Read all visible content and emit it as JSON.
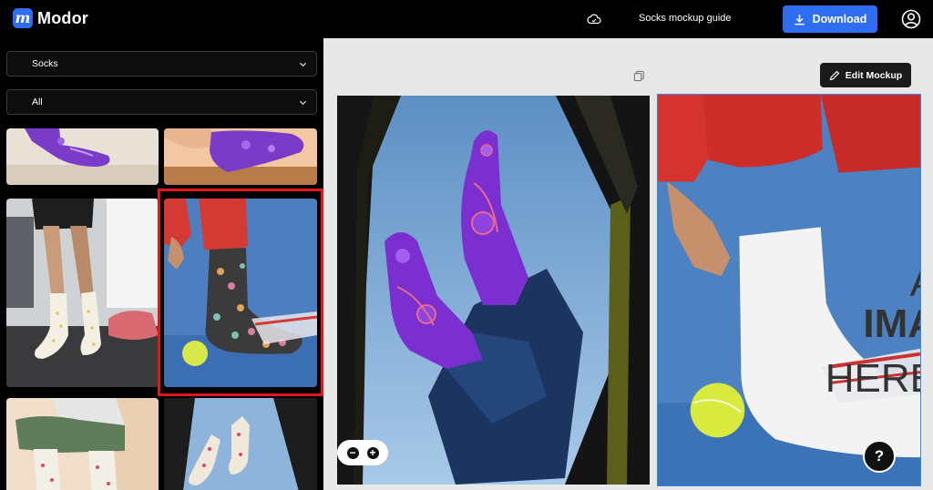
{
  "header": {
    "logo_mark": "m",
    "logo_text": "Modor",
    "guide_link": "Socks mockup guide",
    "download_label": "Download"
  },
  "sidebar": {
    "category_select": "Socks",
    "filter_select": "All",
    "thumbnails": [
      {
        "name": "purple-sock-on-carpet"
      },
      {
        "name": "purple-sock-on-table"
      },
      {
        "name": "white-dotted-socks-gym"
      },
      {
        "name": "black-floral-sock-tennis",
        "selected": true
      },
      {
        "name": "patterned-socks-sitting"
      },
      {
        "name": "socks-in-car-window"
      }
    ]
  },
  "main": {
    "edit_label": "Edit Mockup",
    "watermark": {
      "line1": "A",
      "line2": "IMA",
      "line3": "HERE"
    },
    "help_label": "?",
    "zoom_out": "−",
    "zoom_in": "+"
  },
  "colors": {
    "accent": "#2f6df0",
    "selection": "#e0161d",
    "main_bg": "#e8e8e8"
  }
}
